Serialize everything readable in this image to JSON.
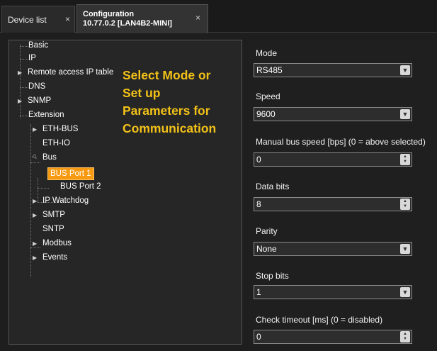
{
  "tabs": [
    {
      "label": "Device list",
      "close": "×"
    },
    {
      "title_line1": "Configuration",
      "title_line2": "10.77.0.2 [LAN4B2-MINI]",
      "close": "×"
    }
  ],
  "tree": {
    "basic": "Basic",
    "ip": "IP",
    "remote_access": "Remote access IP table",
    "dns": "DNS",
    "snmp": "SNMP",
    "extension": "Extension",
    "eth_bus": "ETH-BUS",
    "eth_io": "ETH-IO",
    "bus": "Bus",
    "bus_port_1": "BUS Port 1",
    "bus_port_2": "BUS Port 2",
    "ip_watchdog": "IP Watchdog",
    "smtp": "SMTP",
    "sntp": "SNTP",
    "modbus": "Modbus",
    "events": "Events",
    "selected_color": "#f79a12"
  },
  "annotation": {
    "line1": "Select Mode or",
    "line2": "Set up",
    "line3": "Parameters for",
    "line4": "Communication",
    "color": "#f3c218"
  },
  "settings": {
    "mode": {
      "label": "Mode",
      "value": "RS485"
    },
    "speed": {
      "label": "Speed",
      "value": "9600"
    },
    "manual_speed": {
      "label": "Manual bus speed [bps] (0 = above selected)",
      "value": "0"
    },
    "data_bits": {
      "label": "Data bits",
      "value": "8"
    },
    "parity": {
      "label": "Parity",
      "value": "None"
    },
    "stop_bits": {
      "label": "Stop bits",
      "value": "1"
    },
    "check_timeout": {
      "label": "Check timeout [ms] (0 = disabled)",
      "value": "0"
    }
  }
}
